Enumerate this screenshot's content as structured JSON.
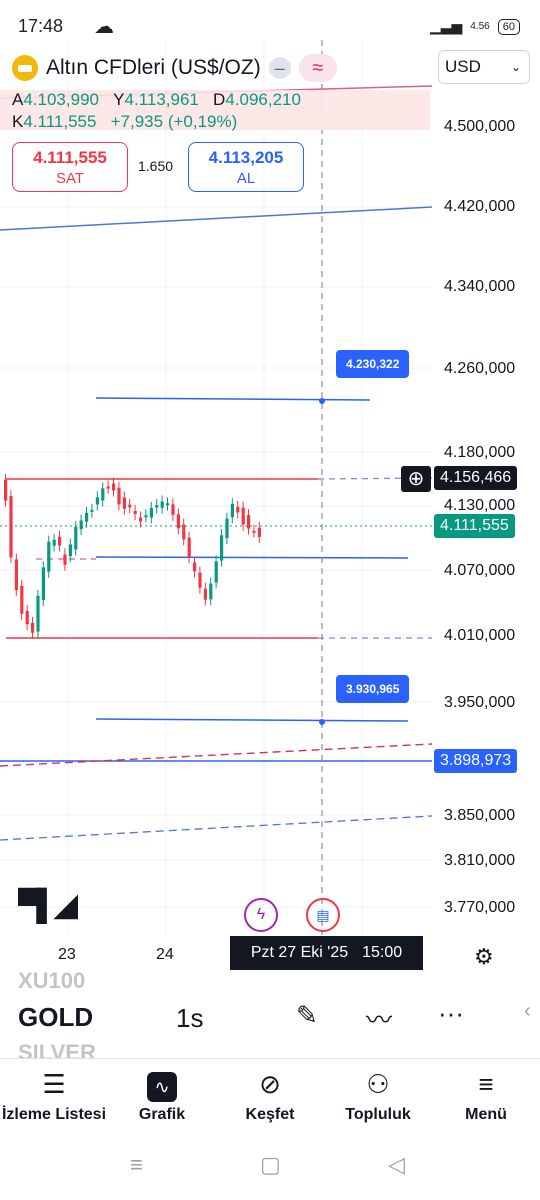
{
  "status_bar": {
    "time": "17:48",
    "battery": "60",
    "signal_text": "4.56"
  },
  "header": {
    "title": "Altın CFDleri (US$/OZ)",
    "currency": "USD"
  },
  "ohlc": {
    "open_label": "A",
    "open": "4.103,990",
    "high_label": "Y",
    "high": "4.113,961",
    "low_label": "D",
    "low": "4.096,210",
    "close_label": "K",
    "close": "4.111,555",
    "change": "+7,935 (+0,19%)"
  },
  "trade": {
    "sell_price": "4.111,555",
    "sell_label": "SAT",
    "spread": "1.650",
    "buy_price": "4.113,205",
    "buy_label": "AL"
  },
  "price_axis": [
    "4.500,000",
    "4.420,000",
    "4.340,000",
    "4.260,000",
    "4.180,000",
    "4.130,000",
    "4.070,000",
    "4.010,000",
    "3.950,000",
    "3.850,000",
    "3.810,000",
    "3.770,000"
  ],
  "price_tags": {
    "crosshair": "4.156,466",
    "current": "4.111,555",
    "line": "3.898,973"
  },
  "annotations": {
    "upper": "4.230,322",
    "lower": "3.930,965"
  },
  "dates": {
    "d1": "23",
    "d2": "24",
    "crosshair_date": "Pzt 27 Eki '25",
    "crosshair_time": "15:00"
  },
  "colors": {
    "up": "#089981",
    "down": "#f23645",
    "accent": "#2962ff",
    "dark": "#131722"
  },
  "toolbar": {
    "prev_symbol": "XU100",
    "symbol": "GOLD",
    "next_symbol": "SILVER",
    "interval": "1s"
  },
  "nav": [
    {
      "label": "İzleme Listesi",
      "icon": "watchlist-icon"
    },
    {
      "label": "Grafik",
      "icon": "chart-icon"
    },
    {
      "label": "Keşfet",
      "icon": "compass-icon"
    },
    {
      "label": "Topluluk",
      "icon": "people-icon"
    },
    {
      "label": "Menü",
      "icon": "menu-icon"
    }
  ]
}
